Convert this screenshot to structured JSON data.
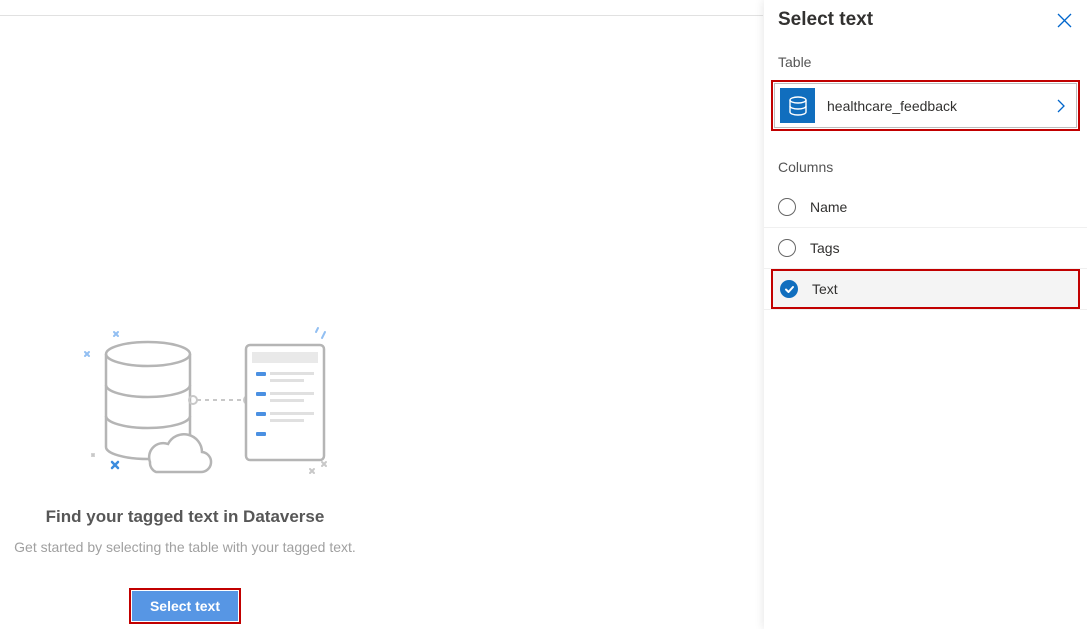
{
  "main": {
    "heading": "Find your tagged text in Dataverse",
    "subtext": "Get started by selecting the table with your tagged text.",
    "button_label": "Select text"
  },
  "panel": {
    "title": "Select text",
    "table_label": "Table",
    "table_selected": "healthcare_feedback",
    "columns_label": "Columns",
    "columns": [
      {
        "name": "Name",
        "selected": false
      },
      {
        "name": "Tags",
        "selected": false
      },
      {
        "name": "Text",
        "selected": true
      }
    ]
  }
}
